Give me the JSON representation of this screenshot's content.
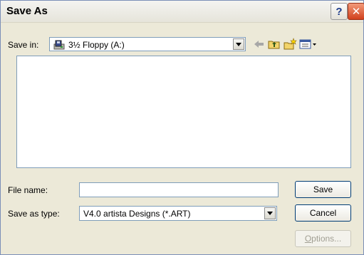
{
  "window": {
    "title": "Save As"
  },
  "titlebar": {
    "help_glyph": "?",
    "close_glyph": "✕"
  },
  "save_in": {
    "label": "Save in:",
    "value": "3½ Floppy (A:)",
    "icon": "floppy-drive-icon"
  },
  "toolbar": {
    "back_icon": "back-arrow-icon",
    "up_icon": "up-folder-icon",
    "new_folder_icon": "new-folder-icon",
    "views_icon": "views-menu-icon"
  },
  "file_list": {
    "items": []
  },
  "file_name": {
    "label": "File name:",
    "value": ""
  },
  "save_as_type": {
    "label": "Save as type:",
    "value": "V4.0 artista Designs (*.ART)"
  },
  "buttons": {
    "save": "Save",
    "cancel": "Cancel",
    "options_mnemonic": "O",
    "options_rest": "ptions..."
  },
  "colors": {
    "dialog_bg": "#ece9d8",
    "field_border": "#7f9db9",
    "close_red": "#d1411d"
  }
}
